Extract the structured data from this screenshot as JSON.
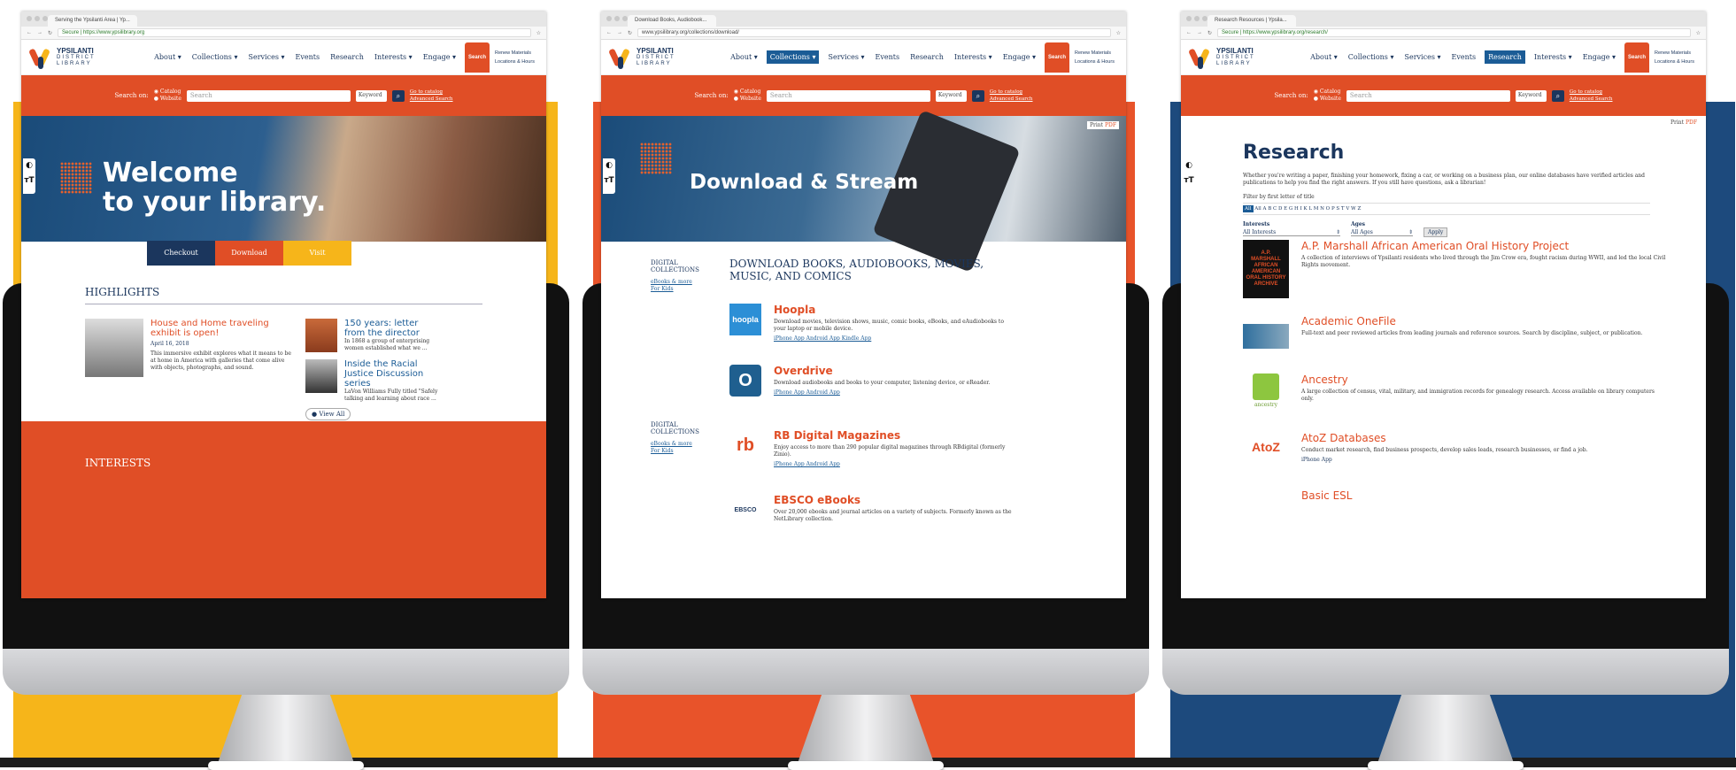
{
  "colors": {
    "yellow": "#f6b51a",
    "orange": "#e04e26",
    "navy": "#1b365d",
    "blue": "#1d4a7d"
  },
  "common": {
    "logo_name": "YPSILANTI",
    "logo_sub1": "DISTRICT",
    "logo_sub2": "LIBRARY",
    "nav": [
      "About ▾",
      "Collections ▾",
      "Services ▾",
      "Events",
      "Research",
      "Interests ▾",
      "Engage ▾"
    ],
    "search_btn": "Search",
    "renew": "Renew Materials",
    "locations": "Locations & Hours",
    "search_on": "Search on:",
    "radio_catalog": "Catalog",
    "radio_website": "Website",
    "search_placeholder": "Search",
    "keyword": "Keyword",
    "go_catalog": "Go to catalog",
    "advanced": "Advanced Search",
    "contrast_icon": "◐",
    "text_icon": "тT"
  },
  "screen1": {
    "tab_title": "Serving the Ypsilanti Area | Yp...",
    "url": "Secure | https://www.ypsilibrary.org",
    "hero_line1": "Welcome",
    "hero_line2": "to your library.",
    "cta": [
      "Checkout",
      "Download",
      "Visit"
    ],
    "highlights": "HIGHLIGHTS",
    "card1_title": "House and Home traveling exhibit is open!",
    "card1_date": "April 16, 2018",
    "card1_text": "This immersive exhibit explores what it means to be at home in America with galleries that come alive with objects, photographs, and sound.",
    "card2_title": "150 years: letter from the director",
    "card2_text": "In 1868 a group of enterprising women established what we ...",
    "card3_title": "Inside the Racial Justice Discussion series",
    "card3_text": "LaVon Williams Fully titled \"Safely talking and learning about race ...",
    "view_all": "View All",
    "interests": "INTERESTS"
  },
  "screen2": {
    "tab_title": "Download Books, Audiobook...",
    "url": "www.ypsilibrary.org/collections/download/",
    "print": "Print",
    "pdf": "PDF",
    "hero": "Download & Stream",
    "side_title": "DIGITAL COLLECTIONS",
    "side_link1": "eBooks & more",
    "side_link2": "For Kids",
    "heading": "DOWNLOAD BOOKS, AUDIOBOOKS, MOVIES, MUSIC, AND COMICS",
    "items": [
      {
        "logo": "hoopla",
        "title": "Hoopla",
        "text": "Download movies, television shows, music, comic books, eBooks, and eAudiobooks to your laptop or mobile device.",
        "links": "iPhone App   Android App   Kindle App"
      },
      {
        "logo": "O",
        "title": "Overdrive",
        "text": "Download audiobooks and books to your computer, listening device, or eReader.",
        "links": "iPhone App   Android App"
      },
      {
        "logo": "rb",
        "title": "RB Digital Magazines",
        "text": "Enjoy access to more than 290 popular digital magazines through RBdigital (formerly Zinio).",
        "links": "iPhone App   Android App"
      },
      {
        "logo": "EBSCO",
        "title": "EBSCO eBooks",
        "text": "Over 20,000 ebooks and journal articles on a variety of subjects. Formerly known as the NetLibrary collection.",
        "links": ""
      }
    ]
  },
  "screen3": {
    "tab_title": "Research Resources | Ypsila...",
    "url": "Secure | https://www.ypsilibrary.org/research/",
    "title": "Research",
    "intro": "Whether you're writing a paper, finishing your homework, fixing a car, or working on a business plan, our online databases have verified articles and publications to help you find the right answers. If you still have questions, ask a librarian!",
    "filter_label": "Filter by first letter of title",
    "letters": "All  A  B  C  D  E  G  H  I  K  L  M  N  O  P  S  T  V  W  Z",
    "interests_label": "Interests",
    "interests_value": "All Interests",
    "ages_label": "Ages",
    "ages_value": "All Ages",
    "apply": "Apply",
    "items": [
      {
        "title": "A.P. Marshall African American Oral History Project",
        "text": "A collection of interviews of Ypsilanti residents who lived through the Jim Crow era, fought racism during WWII, and led the local Civil Rights movement."
      },
      {
        "title": "Academic OneFile",
        "text": "Full-text and peer reviewed articles from leading journals and reference sources. Search by discipline, subject, or publication."
      },
      {
        "title": "Ancestry",
        "text": "A large collection of census, vital, military, and immigration records for genealogy research. Access available on library computers only."
      },
      {
        "title": "AtoZ Databases",
        "text": "Conduct market research, find business prospects, develop sales leads, research businesses, or find a job."
      },
      {
        "title": "Basic ESL",
        "text": ""
      }
    ],
    "ap_logo": "A.P. MARSHALL AFRICAN AMERICAN ORAL HISTORY ARCHIVE",
    "ancestry_logo": "ancestry",
    "atoz_logo": "AtoZ",
    "iphone_app": "iPhone App"
  }
}
